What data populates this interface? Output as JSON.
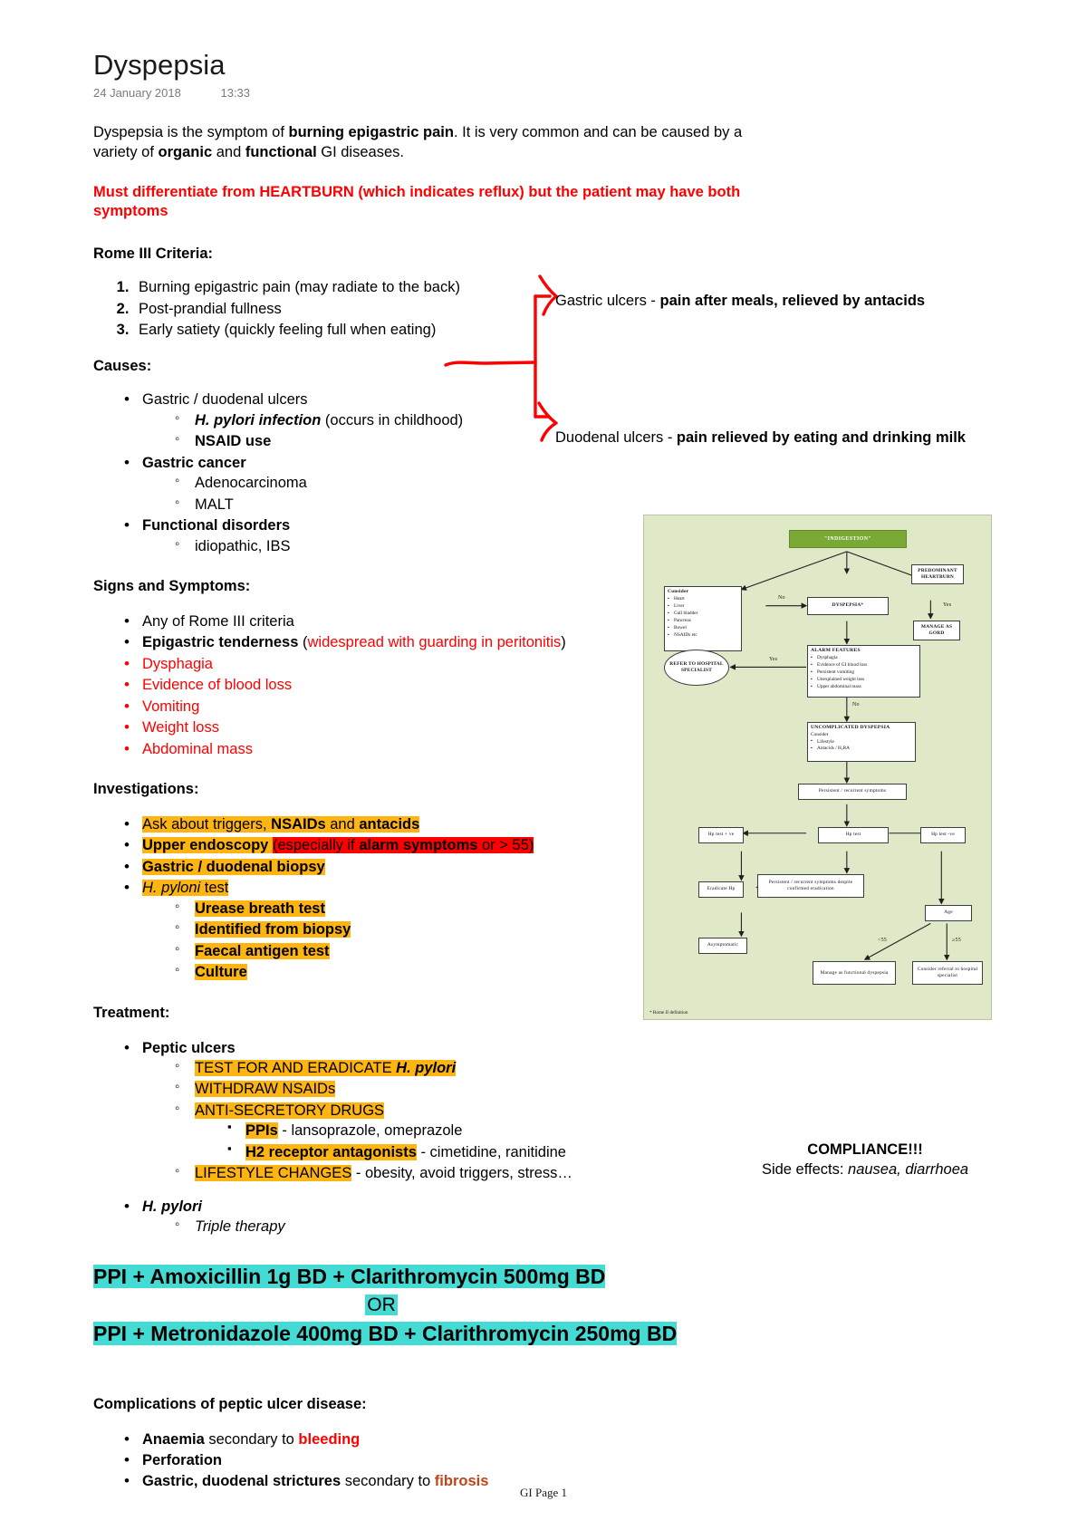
{
  "document": {
    "title": "Dyspepsia",
    "date": "24 January 2018",
    "time": "13:33",
    "footer": "GI Page 1"
  },
  "intro": {
    "part1": "Dyspepsia is the symptom of ",
    "bold1": "burning epigastric pain",
    "part2": ". It is very common and can be caused by a variety of ",
    "bold2": "organic",
    "part3": " and ",
    "bold3": "functional",
    "part4": " GI diseases."
  },
  "warning": "Must differentiate from HEARTBURN (which indicates reflux) but the patient may have both symptoms",
  "rome": {
    "heading": "Rome III Criteria:",
    "items": [
      "Burning epigastric pain (may radiate to the back)",
      "Post-prandial fullness",
      "Early satiety (quickly feeling full when eating)"
    ]
  },
  "causes": {
    "heading": "Causes:",
    "items": [
      {
        "label": "Gastric / duodenal ulcers",
        "bold": false,
        "sub": [
          {
            "bold_part": "H. pylori infection",
            "rest": " (occurs in childhood)",
            "italic_bold": true
          },
          {
            "bold_part": "NSAID use",
            "rest": "",
            "italic_bold": false
          }
        ]
      },
      {
        "label": "Gastric cancer",
        "bold": true,
        "sub": [
          {
            "bold_part": "",
            "rest": "Adenocarcinoma",
            "italic_bold": false
          },
          {
            "bold_part": "",
            "rest": "MALT",
            "italic_bold": false
          }
        ]
      },
      {
        "label": "Functional disorders",
        "bold": true,
        "sub": [
          {
            "bold_part": "",
            "rest": "idiopathic, IBS",
            "italic_bold": false
          }
        ]
      }
    ]
  },
  "annotations": {
    "gastric_plain": "Gastric ulcers - ",
    "gastric_bold": "pain after meals, relieved by antacids",
    "duodenal_plain": "Duodenal ulcers - ",
    "duodenal_bold": "pain relieved by eating and drinking milk",
    "ink_color": "#ff0000"
  },
  "signs": {
    "heading": "Signs and Symptoms:",
    "item1": "Any of Rome III criteria",
    "item2_bold": "Epigastric tenderness",
    "item2_paren_open": " (",
    "item2_red": "widespread with guarding in peritonitis",
    "item2_paren_close": ")",
    "red_items": [
      "Dysphagia",
      "Evidence of blood loss",
      "Vomiting",
      "Weight loss",
      "Abdominal mass"
    ]
  },
  "investigations": {
    "heading": "Investigations:",
    "item1_plain": "Ask about triggers, ",
    "item1_bold1": "NSAIDs",
    "item1_mid": " and ",
    "item1_bold2": "antacids",
    "item2_bold": "Upper endoscopy",
    "item2_red_a": "(especially if ",
    "item2_red_bold": "alarm symptoms",
    "item2_red_b": " or > 55)",
    "item3": "Gastric / duodenal biopsy",
    "item4_italic": "H. pyloni",
    "item4_rest": " test",
    "hp_tests": [
      "Urease breath test",
      "Identified from biopsy",
      "Faecal antigen test",
      "Culture"
    ]
  },
  "treatment": {
    "heading": "Treatment:",
    "peptic_label": "Peptic ulcers",
    "peptic_sub": [
      {
        "hl": "TEST FOR AND ERADICATE ",
        "hl_italic": "H. pylori",
        "rest": ""
      },
      {
        "hl": "WITHDRAW NSAIDs",
        "hl_italic": "",
        "rest": ""
      },
      {
        "hl": "ANTI-SECRETORY DRUGS",
        "hl_italic": "",
        "rest": ""
      }
    ],
    "drugs": [
      {
        "hl_bold": "PPIs",
        "rest": " - lansoprazole, omeprazole"
      },
      {
        "hl_bold": "H2 receptor antagonists",
        "rest": " - cimetidine, ranitidine"
      }
    ],
    "lifestyle_hl": "LIFESTYLE CHANGES",
    "lifestyle_rest": " - obesity, avoid triggers, stress…",
    "hpylori_label": "H. pylori",
    "hpylori_sub": "Triple therapy"
  },
  "regimens": {
    "line1": "PPI + Amoxicillin 1g BD + Clarithromycin 500mg BD",
    "or": "OR",
    "line2": "PPI + Metronidazole 400mg BD + Clarithromycin 250mg BD",
    "highlight_color": "#45dbd5"
  },
  "compliance": {
    "title": "COMPLIANCE!!!",
    "prefix": "Side effects: ",
    "effects": "nausea, diarrhoea"
  },
  "complications": {
    "heading": "Complications of peptic ulcer disease:",
    "item1_bold": "Anaemia",
    "item1_mid": " secondary to ",
    "item1_red": "bleeding",
    "item2_bold": "Perforation",
    "item3_bold": "Gastric, duodenal strictures",
    "item3_mid": " secondary to ",
    "item3_brown": "fibrosis"
  },
  "flowchart": {
    "header": "\"INDIGESTION\"",
    "consider_title": "Consider",
    "consider_items": [
      "Heart",
      "Liver",
      "Gall bladder",
      "Pancreas",
      "Bowel",
      "NSAIDs etc"
    ],
    "dyspepsia": "DYSPEPSIA*",
    "predominant": "PREDOMINANT HEARTBURN",
    "manage_gord": "MANAGE AS GORD",
    "alarm_title": "ALARM FEATURES",
    "alarm_items": [
      "Dysphagia",
      "Evidence of GI blood loss",
      "Persistent vomiting",
      "Unexplained weight loss",
      "Upper abdominal mass"
    ],
    "refer": "REFER TO HOSPITAL SPECIALIST",
    "uncomplicated_title": "UNCOMPLICATED DYSPEPSIA",
    "uncomplicated_consider": "Consider",
    "uncomplicated_items": [
      "Lifestyle",
      "Antacids / H₂RA"
    ],
    "persistent1": "Persistent / recurrent symptoms",
    "hp_test": "Hp test",
    "hp_pos": "Hp test + ve",
    "hp_neg": "Hp test -ve",
    "eradicate": "Eradicate Hp",
    "persistent2": "Persistent / recurrent symptoms despite confirmed eradication",
    "asymptomatic": "Asymptomatic",
    "age": "Age",
    "manage_functional": "Manage as functional dyspepsia",
    "consider_referral": "Consider referral to hospital specialist",
    "label_no1": "No",
    "label_no2": "No",
    "label_yes1": "Yes",
    "label_yes2": "Yes",
    "label_under55": "<55",
    "label_over55": "≥55",
    "footnote": "* Rome II definition",
    "bg_color": "#dfe9c8",
    "header_color": "#7aaa35"
  }
}
